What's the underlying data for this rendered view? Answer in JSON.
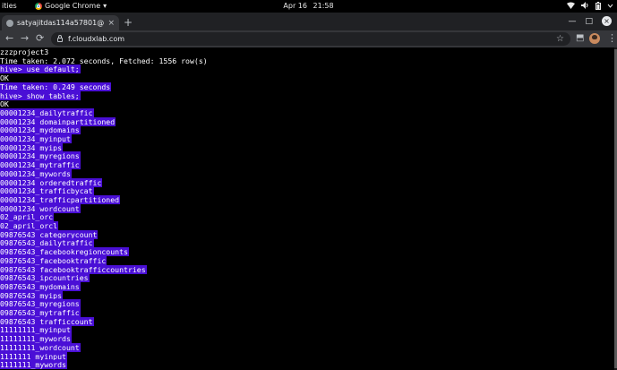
{
  "system_bar": {
    "activities": "ities",
    "app_name": "Google Chrome",
    "app_menu_arrow": "▾",
    "date": "Apr 16",
    "time": "21:58",
    "tray_icons": [
      "network-icon",
      "volume-icon",
      "battery-icon",
      "power-arrow-icon"
    ]
  },
  "browser": {
    "tab": {
      "title": "satyajitdas114a57801@",
      "close": "×"
    },
    "new_tab": "+",
    "window_controls": {
      "minimize": "—",
      "maximize": "□",
      "close": "×"
    },
    "nav": {
      "back": "←",
      "forward": "→",
      "reload": "⟳"
    },
    "address": "f.cloudxlab.com",
    "bookmark": "☆",
    "extensions": "⬒",
    "menu": "⋮"
  },
  "terminal": {
    "lines": [
      {
        "text": "zzzproject3",
        "selected": false
      },
      {
        "text": "Time taken: 2.072 seconds, Fetched: 1556 row(s)",
        "selected": false
      },
      {
        "text": "hive> use default;",
        "selected": true
      },
      {
        "text": "OK",
        "selected": false
      },
      {
        "text": "Time taken: 0.249 seconds",
        "selected": true
      },
      {
        "text": "hive> show tables;",
        "selected": true
      },
      {
        "text": "OK",
        "selected": false
      },
      {
        "text": "00001234_dailytraffic",
        "selected": true
      },
      {
        "text": "00001234_domainpartitioned",
        "selected": true
      },
      {
        "text": "00001234_mydomains",
        "selected": true
      },
      {
        "text": "00001234_myinput",
        "selected": true
      },
      {
        "text": "00001234_myips",
        "selected": true
      },
      {
        "text": "00001234_myregions",
        "selected": true
      },
      {
        "text": "00001234_mytraffic",
        "selected": true
      },
      {
        "text": "00001234_mywords",
        "selected": true
      },
      {
        "text": "00001234_orderedtraffic",
        "selected": true
      },
      {
        "text": "00001234_trafficbycat",
        "selected": true
      },
      {
        "text": "00001234_trafficpartitioned",
        "selected": true
      },
      {
        "text": "00001234_wordcount",
        "selected": true
      },
      {
        "text": "02_april_orc",
        "selected": true
      },
      {
        "text": "02_april_orcl",
        "selected": true
      },
      {
        "text": "09876543_categorycount",
        "selected": true
      },
      {
        "text": "09876543_dailytraffic",
        "selected": true
      },
      {
        "text": "09876543_facebookregioncounts",
        "selected": true
      },
      {
        "text": "09876543_facebooktraffic",
        "selected": true
      },
      {
        "text": "09876543_facebooktrafficcountries",
        "selected": true
      },
      {
        "text": "09876543_ipcountries",
        "selected": true
      },
      {
        "text": "09876543_mydomains",
        "selected": true
      },
      {
        "text": "09876543_myips",
        "selected": true
      },
      {
        "text": "09876543_myregions",
        "selected": true
      },
      {
        "text": "09876543_mytraffic",
        "selected": true
      },
      {
        "text": "09876543_trafficcount",
        "selected": true
      },
      {
        "text": "11111111_myinput",
        "selected": true
      },
      {
        "text": "11111111_mywords",
        "selected": true
      },
      {
        "text": "11111111_wordcount",
        "selected": true
      },
      {
        "text": "1111111_myinput",
        "selected": true
      },
      {
        "text": "1111111_mywords",
        "selected": true
      }
    ]
  }
}
